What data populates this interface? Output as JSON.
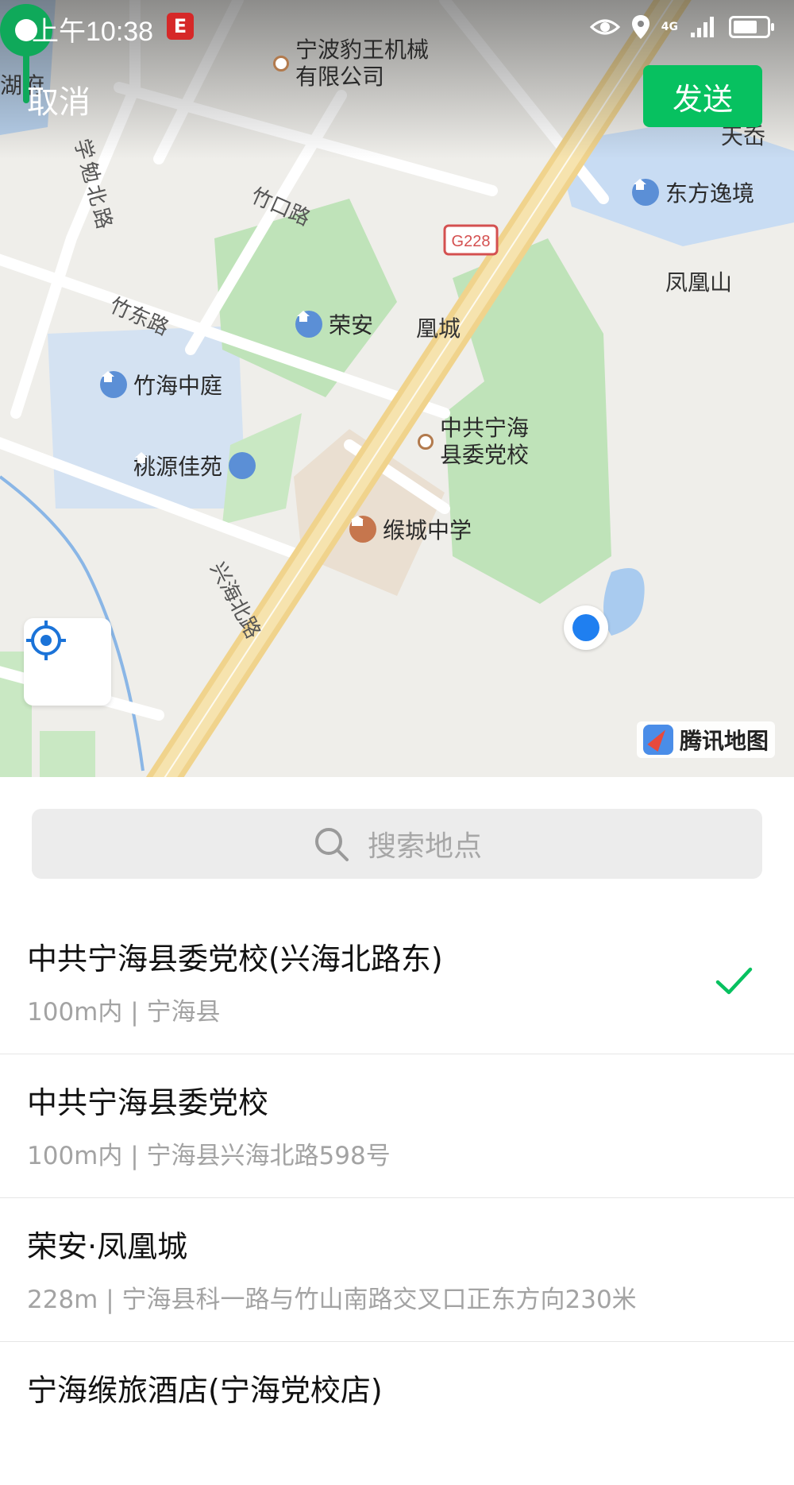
{
  "status_bar": {
    "time": "上午10:38",
    "app_badge": "E",
    "network": "4G"
  },
  "header": {
    "cancel_label": "取消",
    "send_label": "发送"
  },
  "map": {
    "labels": {
      "lake_fragment": "湖府",
      "company_line1": "宁波豹王机械",
      "company_line2": "有限公司",
      "tian_fragment": "天岙",
      "dongfang": "东方逸境",
      "fenghuangshan": "凤凰山",
      "rongan": "荣安",
      "rongan_tail": "凰城",
      "zhuhai": "竹海中庭",
      "dangxiao_line1": "中共宁海",
      "dangxiao_line2": "县委党校",
      "taoyuan": "桃源佳苑",
      "school": "缑城中学"
    },
    "roads": {
      "xuemian": "学勉北路",
      "zhukou": "竹口路",
      "zhudong": "竹东路",
      "xinghai": "兴海北路",
      "g228": "G228"
    },
    "provider": "腾讯地图"
  },
  "search": {
    "placeholder": "搜索地点"
  },
  "results": [
    {
      "title": "中共宁海县委党校(兴海北路东)",
      "subtitle": "100m内 | 宁海县",
      "selected": true
    },
    {
      "title": "中共宁海县委党校",
      "subtitle": "100m内 | 宁海县兴海北路598号",
      "selected": false
    },
    {
      "title": "荣安·凤凰城",
      "subtitle": "228m | 宁海县科一路与竹山南路交叉口正东方向230米",
      "selected": false
    },
    {
      "title": "宁海缑旅酒店(宁海党校店)",
      "subtitle": "",
      "selected": false
    }
  ],
  "colors": {
    "accent": "#07c160",
    "pin": "#0fa95a",
    "current_location": "#1f7ff0"
  }
}
